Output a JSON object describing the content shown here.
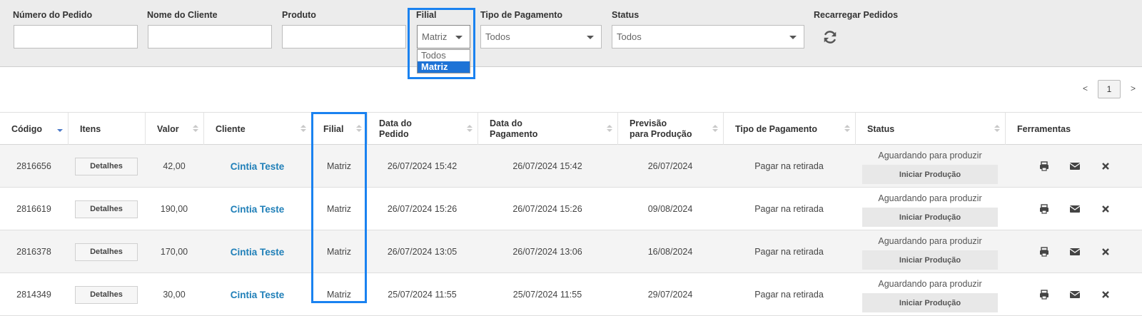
{
  "filters": {
    "numero_pedido": {
      "label": "Número do Pedido",
      "value": ""
    },
    "nome_cliente": {
      "label": "Nome do Cliente",
      "value": ""
    },
    "produto": {
      "label": "Produto",
      "value": ""
    },
    "filial": {
      "label": "Filial",
      "value": "Matriz",
      "options": [
        "Todos",
        "Matriz"
      ],
      "selected": "Matriz"
    },
    "tipo_pagamento": {
      "label": "Tipo de Pagamento",
      "value": "Todos"
    },
    "status": {
      "label": "Status",
      "value": "Todos"
    },
    "recarregar": {
      "label": "Recarregar Pedidos",
      "icon": "refresh-icon"
    }
  },
  "pagination": {
    "prev": "<",
    "current": "1",
    "next": ">"
  },
  "table": {
    "headers": [
      {
        "line1": "Código",
        "line2": ""
      },
      {
        "line1": "Itens",
        "line2": ""
      },
      {
        "line1": "Valor",
        "line2": ""
      },
      {
        "line1": "Cliente",
        "line2": ""
      },
      {
        "line1": "Filial",
        "line2": ""
      },
      {
        "line1": "Data do",
        "line2": "Pedido"
      },
      {
        "line1": "Data do",
        "line2": "Pagamento"
      },
      {
        "line1": "Previsão",
        "line2": "para Produção"
      },
      {
        "line1": "Tipo de Pagamento",
        "line2": ""
      },
      {
        "line1": "Status",
        "line2": ""
      },
      {
        "line1": "Ferramentas",
        "line2": ""
      }
    ],
    "detalhes_label": "Detalhes",
    "iniciar_label": "Iniciar Produção",
    "rows": [
      {
        "codigo": "2816656",
        "valor": "42,00",
        "cliente": "Cintia Teste",
        "filial": "Matriz",
        "data_pedido": "26/07/2024 15:42",
        "data_pagamento": "26/07/2024 15:42",
        "previsao": "26/07/2024",
        "tipo_pagamento": "Pagar na retirada",
        "status": "Aguardando para produzir"
      },
      {
        "codigo": "2816619",
        "valor": "190,00",
        "cliente": "Cintia Teste",
        "filial": "Matriz",
        "data_pedido": "26/07/2024 15:26",
        "data_pagamento": "26/07/2024 15:26",
        "previsao": "09/08/2024",
        "tipo_pagamento": "Pagar na retirada",
        "status": "Aguardando para produzir"
      },
      {
        "codigo": "2816378",
        "valor": "170,00",
        "cliente": "Cintia Teste",
        "filial": "Matriz",
        "data_pedido": "26/07/2024 13:05",
        "data_pagamento": "26/07/2024 13:06",
        "previsao": "16/08/2024",
        "tipo_pagamento": "Pagar na retirada",
        "status": "Aguardando para produzir"
      },
      {
        "codigo": "2814349",
        "valor": "30,00",
        "cliente": "Cintia Teste",
        "filial": "Matriz",
        "data_pedido": "25/07/2024 11:55",
        "data_pagamento": "25/07/2024 11:55",
        "previsao": "29/07/2024",
        "tipo_pagamento": "Pagar na retirada",
        "status": "Aguardando para produzir"
      }
    ],
    "tools": [
      "print-icon",
      "envelope-icon",
      "close-icon"
    ]
  },
  "colors": {
    "highlight": "#1a82f0",
    "cliente_link": "#1f7fb8",
    "selected_option": "#1e73d6"
  }
}
